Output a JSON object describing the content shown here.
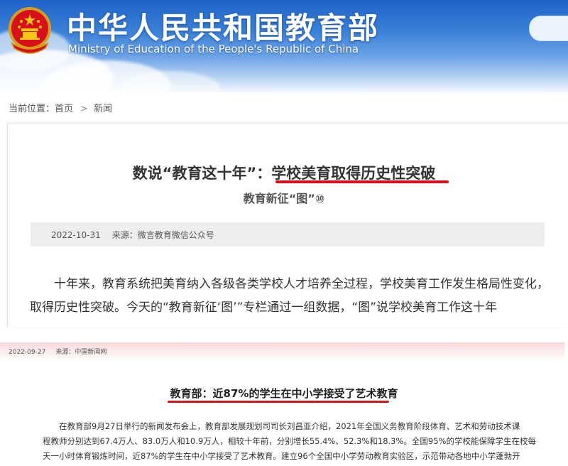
{
  "header": {
    "title": "中华人民共和国教育部",
    "subtitle": "Ministry of Education of the People's Republic of China",
    "emblem_icon": "national-emblem-icon"
  },
  "breadcrumb": {
    "label": "当前位置：",
    "home": "首页",
    "separator": ">",
    "current": "新闻"
  },
  "article1": {
    "title_prefix": "数说“教育这十年”：",
    "title_highlight": "学校美育取得历史性突破",
    "subtitle": "教育新征“图”⑩",
    "date": "2022-10-31",
    "source": "来源：微言教育微信公众号",
    "body_lines": [
      "十年来，教育系统把美育纳入各级各类学校人才培养全过程，学校美育工作发生格局性变化，",
      "取得历史性突破。今天的“教育新征‘图’”专栏通过一组数据，“图”说学校美育工作这十年"
    ]
  },
  "article2": {
    "date": "2022-09-27",
    "source": "来源：中国新闻网",
    "title": "教育部：近87%的学生在中小学接受了艺术教育",
    "body_lines": [
      "在教育部9月27日举行的新闻发布会上，教育部发展规划司司长刘昌亚介绍，2021年全国义务教育阶段体育、艺术和劳动技术课",
      "程教师分别达到67.4万人、83.0万人和10.9万人，相较十年前，分别增长55.4%、52.3%和18.3%。全国95%的学校能保障学生在校每",
      "天一小时体育锻炼时间，近87%的学生在中小学接受了艺术教育。建立96个全国中小学劳动教育实验区，示范带动各地中小学蓬勃开"
    ]
  },
  "colors": {
    "banner_top": "#1e63c8",
    "highlight_underline": "#d7101a",
    "meta_bg": "#eeeeee",
    "meta_bar_pink": "#f8d9da"
  }
}
